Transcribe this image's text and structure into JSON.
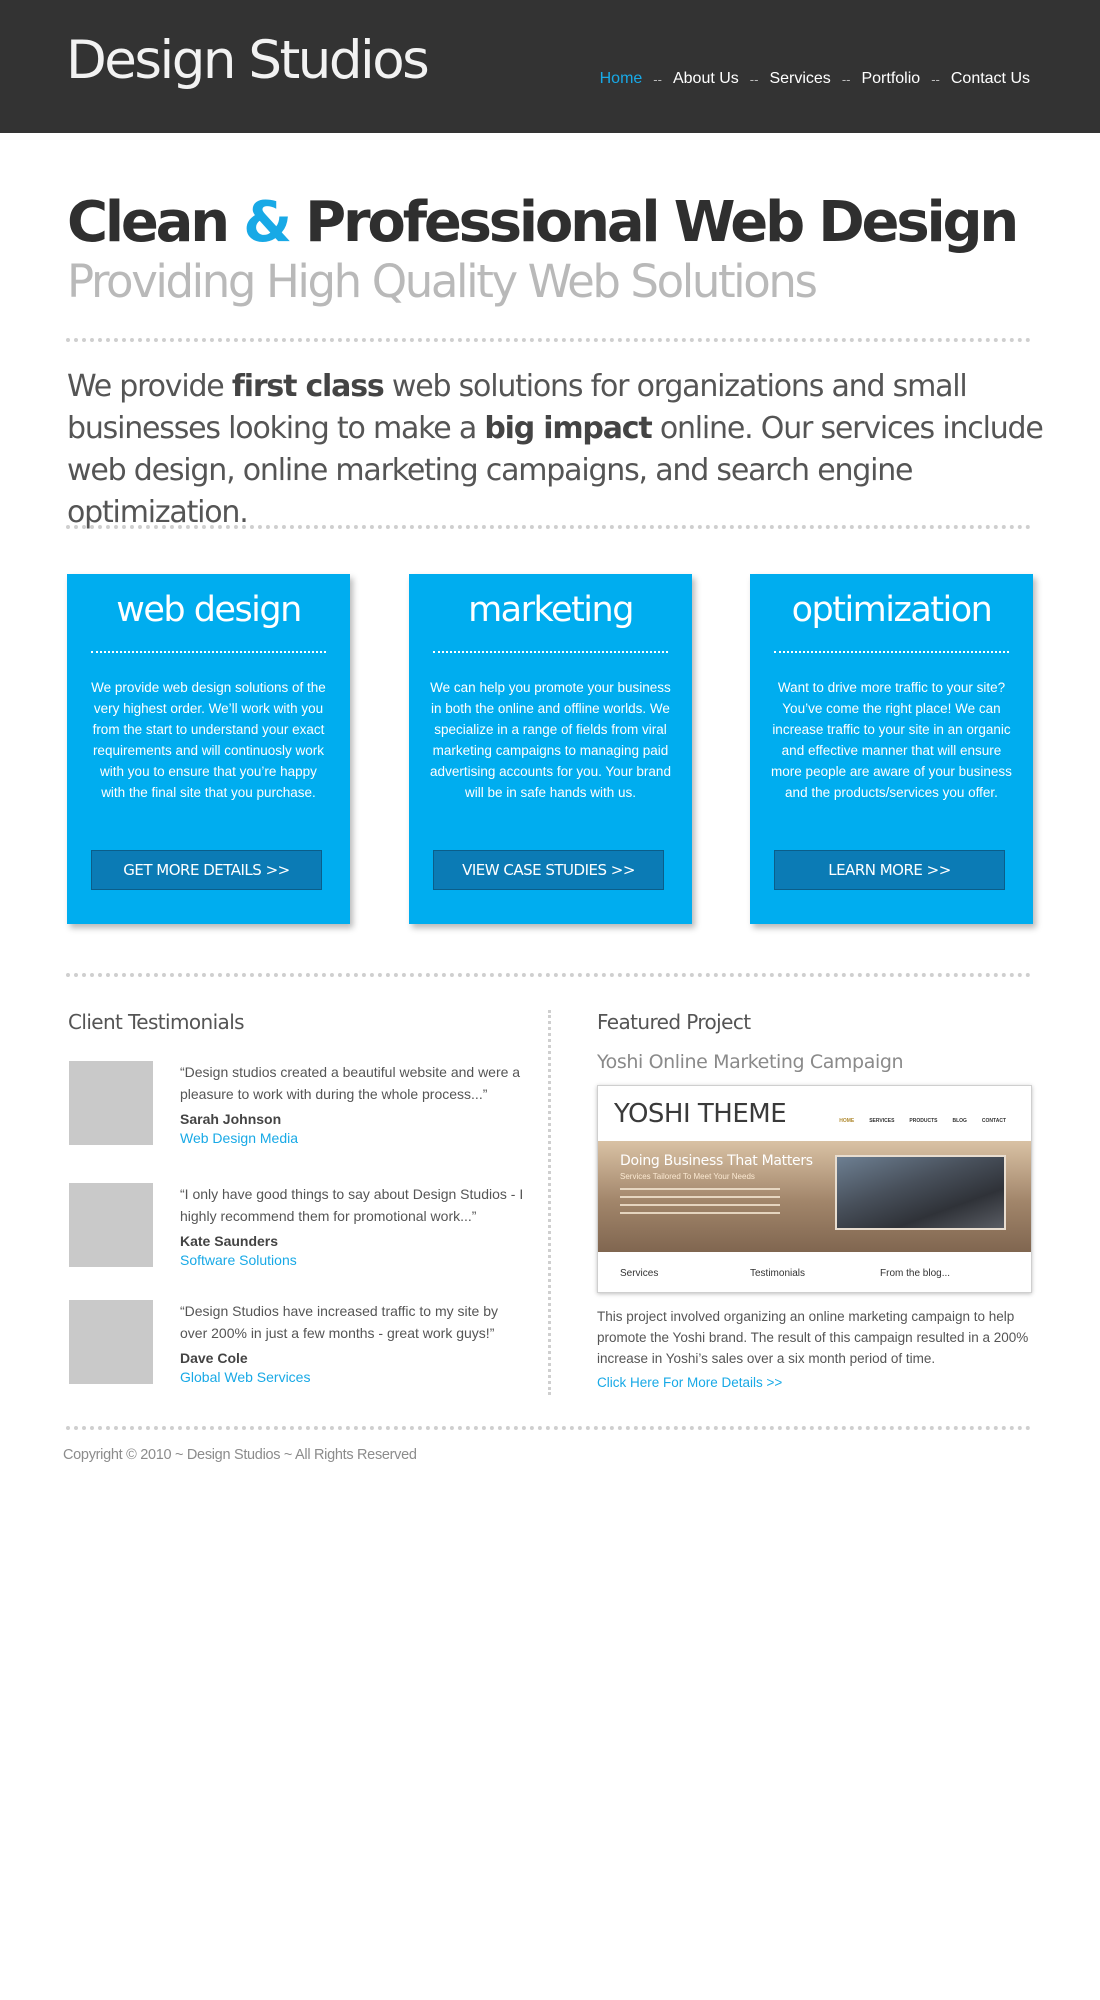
{
  "header": {
    "logo": "Design Studios",
    "nav": [
      "Home",
      "About Us",
      "Services",
      "Portfolio",
      "Contact Us"
    ],
    "nav_separator": "--",
    "active_index": 0
  },
  "hero": {
    "title_part1": "Clean",
    "title_amp": "&",
    "title_part2": "Professional Web Design",
    "subtitle": "Providing High Quality Web Solutions"
  },
  "intro": {
    "t1": "We provide ",
    "b1": "first class",
    "t2": " web solutions for organizations and small businesses looking to make a ",
    "b2": "big impact",
    "t3": " online. Our services include web design, online marketing campaigns, and search engine optimization."
  },
  "services": [
    {
      "title": "web design",
      "text": "We provide web design solutions of the very highest order. We’ll work with you from the start to understand your exact requirements and will continuosly work with you to ensure that you’re happy with the final site that you purchase.",
      "button": "GET MORE DETAILS >>"
    },
    {
      "title": "marketing",
      "text": "We can help you promote your business in both the online and offline worlds. We specialize in a range of fields from viral marketing campaigns to managing paid advertising accounts for you. Your brand will be in safe hands with us.",
      "button": "VIEW CASE STUDIES >>"
    },
    {
      "title": "optimization",
      "text": "Want to drive more traffic to your site? You’ve come the right place! We can increase traffic to your site in an organic and effective manner that will ensure more people are aware of your business and the products/services you offer.",
      "button": "LEARN MORE >>"
    }
  ],
  "testimonials": {
    "title": "Client Testimonials",
    "items": [
      {
        "quote": "“Design studios created a beautiful website and were a pleasure to work with during the whole process...”",
        "name": "Sarah Johnson",
        "company": "Web Design Media"
      },
      {
        "quote": "“I only have good things to say about Design Studios - I highly recommend them for promotional work...”",
        "name": "Kate Saunders",
        "company": "Software Solutions"
      },
      {
        "quote": "“Design Studios have increased traffic to my site by over 200% in just a few months - great work guys!”",
        "name": "Dave Cole",
        "company": "Global Web Services"
      }
    ]
  },
  "featured": {
    "title": "Featured Project",
    "subtitle": "Yoshi Online Marketing Campaign",
    "screenshot": {
      "brand": "YOSHI THEME",
      "nav": [
        "HOME",
        "SERVICES",
        "PRODUCTS",
        "BLOG",
        "CONTACT"
      ],
      "headline": "Doing Business That Matters",
      "subhead": "Services Tailored To Meet Your Needs",
      "columns": [
        "Services",
        "Testimonials",
        "From the blog..."
      ]
    },
    "description": "This project involved organizing an online marketing campaign to help promote the Yoshi brand. The result of this campaign resulted in a 200% increase in Yoshi’s sales over a six month period of time.",
    "link": "Click Here For More Details >>"
  },
  "footer": {
    "copyright": "Copyright © 2010 ~ Design Studios ~ All Rights Reserved"
  },
  "colors": {
    "header_bg": "#333333",
    "accent": "#18a9e6",
    "box_bg": "#00adef",
    "button_bg": "#0b7bb5"
  }
}
